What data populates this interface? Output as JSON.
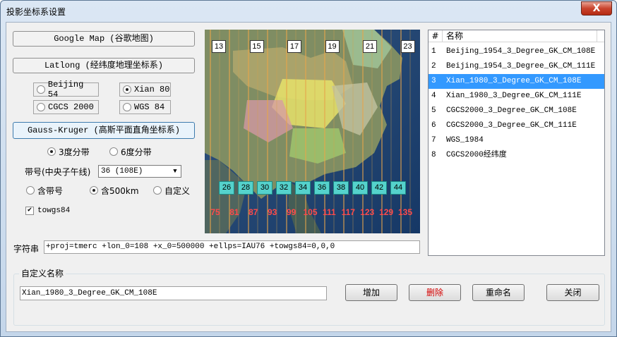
{
  "window": {
    "title": "投影坐标系设置",
    "close_glyph": "X"
  },
  "left": {
    "google_map_btn": "Google Map (谷歌地图)",
    "latlong_btn": "Latlong (经纬度地理坐标系)",
    "datum_options": [
      {
        "label": "Beijing 54",
        "checked": false
      },
      {
        "label": "Xian 80",
        "checked": true
      },
      {
        "label": "CGCS 2000",
        "checked": false
      },
      {
        "label": "WGS 84",
        "checked": false
      }
    ],
    "gauss_btn": "Gauss-Kruger (高斯平面直角坐标系)",
    "zone_width": [
      {
        "label": "3度分带",
        "checked": true
      },
      {
        "label": "6度分带",
        "checked": false
      }
    ],
    "zone_label": "带号(中央子午线)",
    "zone_value": "36 (108E)",
    "false_easting": [
      {
        "label": "含带号",
        "checked": false
      },
      {
        "label": "含500km",
        "checked": true
      },
      {
        "label": "自定义",
        "checked": false
      }
    ],
    "towgs84_label": "towgs84",
    "towgs84_checked": true
  },
  "map": {
    "top_zones": [
      "13",
      "15",
      "17",
      "19",
      "21",
      "23"
    ],
    "mid_zones": [
      "26",
      "28",
      "30",
      "32",
      "34",
      "36",
      "38",
      "40",
      "42",
      "44"
    ],
    "meridians": [
      "75",
      "81",
      "87",
      "93",
      "99",
      "105",
      "111",
      "117",
      "123",
      "129",
      "135"
    ]
  },
  "string_row": {
    "label": "字符串",
    "value": "+proj=tmerc +lon_0=108 +x_0=500000 +ellps=IAU76 +towgs84=0,0,0"
  },
  "list": {
    "col_num": "#",
    "col_name": "名称",
    "rows": [
      {
        "n": "1",
        "name": "Beijing_1954_3_Degree_GK_CM_108E",
        "selected": false
      },
      {
        "n": "2",
        "name": "Beijing_1954_3_Degree_GK_CM_111E",
        "selected": false
      },
      {
        "n": "3",
        "name": "Xian_1980_3_Degree_GK_CM_108E",
        "selected": true
      },
      {
        "n": "4",
        "name": "Xian_1980_3_Degree_GK_CM_111E",
        "selected": false
      },
      {
        "n": "5",
        "name": "CGCS2000_3_Degree_GK_CM_108E",
        "selected": false
      },
      {
        "n": "6",
        "name": "CGCS2000_3_Degree_GK_CM_111E",
        "selected": false
      },
      {
        "n": "7",
        "name": "WGS_1984",
        "selected": false
      },
      {
        "n": "8",
        "name": "CGCS2000经纬度",
        "selected": false
      }
    ]
  },
  "custom": {
    "legend": "自定义名称",
    "value": "Xian_1980_3_Degree_GK_CM_108E",
    "add": "增加",
    "delete": "删除",
    "rename": "重命名",
    "close": "关闭",
    "delete_color": "#d40000"
  }
}
